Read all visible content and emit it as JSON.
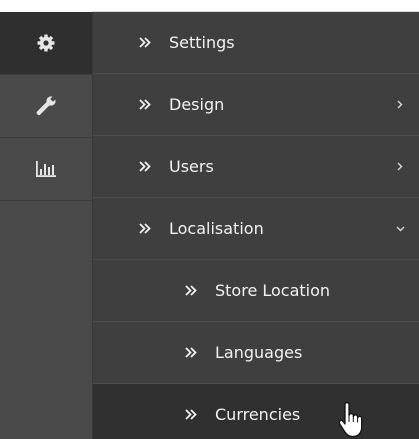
{
  "icon_rail": {
    "items": [
      {
        "icon": "gear-icon",
        "active": true
      },
      {
        "icon": "wrench-icon",
        "active": false
      },
      {
        "icon": "bar-chart-icon",
        "active": false
      }
    ]
  },
  "menu": {
    "items": [
      {
        "label": "Settings",
        "level": 0,
        "caret": "none"
      },
      {
        "label": "Design",
        "level": 0,
        "caret": "chevron-right-icon"
      },
      {
        "label": "Users",
        "level": 0,
        "caret": "chevron-right-icon"
      },
      {
        "label": "Localisation",
        "level": 0,
        "caret": "chevron-down-icon"
      },
      {
        "label": "Store Location",
        "level": 1,
        "caret": "none"
      },
      {
        "label": "Languages",
        "level": 1,
        "caret": "none"
      },
      {
        "label": "Currencies",
        "level": 1,
        "caret": "none",
        "hovered": true
      }
    ]
  },
  "colors": {
    "rail_bg": "#4a4a4a",
    "rail_active_bg": "#2f2f2f",
    "menu_bg": "#3f3f3f",
    "menu_hover_bg": "#303030",
    "text": "#f2f2f2",
    "icon": "#e6e6e6"
  }
}
